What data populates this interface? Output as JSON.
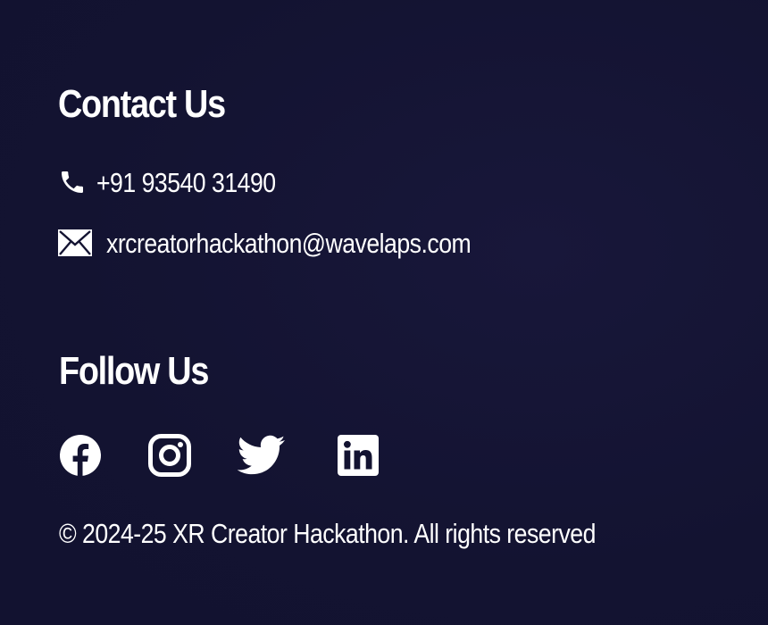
{
  "contact": {
    "heading": "Contact Us",
    "phone": {
      "icon": "phone-icon",
      "text": "+91 93540 31490"
    },
    "email": {
      "icon": "envelope-icon",
      "text": "xrcreatorhackathon@wavelaps.com"
    }
  },
  "follow": {
    "heading": "Follow Us",
    "links": [
      {
        "icon": "facebook-icon"
      },
      {
        "icon": "instagram-icon"
      },
      {
        "icon": "twitter-icon"
      },
      {
        "icon": "linkedin-icon"
      }
    ]
  },
  "copyright": "© 2024-25 XR Creator Hackathon. All rights reserved",
  "colors": {
    "background": "#131331",
    "text": "#ffffff"
  }
}
